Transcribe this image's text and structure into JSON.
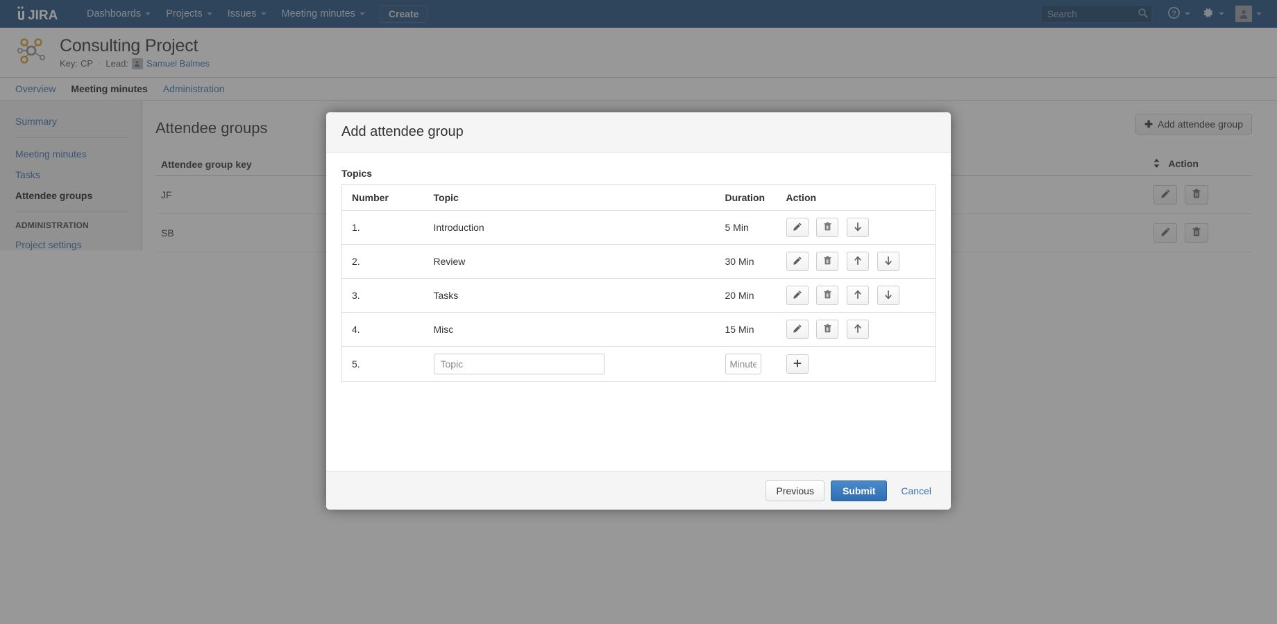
{
  "topnav": {
    "logo_text": "JIRA",
    "items": [
      {
        "label": "Dashboards",
        "has_caret": true
      },
      {
        "label": "Projects",
        "has_caret": true
      },
      {
        "label": "Issues",
        "has_caret": true
      },
      {
        "label": "Meeting minutes",
        "has_caret": true
      }
    ],
    "create_label": "Create",
    "search_placeholder": "Search",
    "search_value": "",
    "icons": [
      "search-icon",
      "help-icon",
      "gear-icon",
      "user-avatar-icon"
    ]
  },
  "project": {
    "title": "Consulting Project",
    "key_label": "Key:",
    "key_value": "CP",
    "separator": "·",
    "lead_label": "Lead:",
    "lead_name": "Samuel Balmes",
    "tabs": [
      {
        "label": "Overview",
        "active": false
      },
      {
        "label": "Meeting minutes",
        "active": true
      },
      {
        "label": "Administration",
        "active": false
      }
    ]
  },
  "sidebar": {
    "items": [
      {
        "label": "Summary",
        "active": false
      },
      {
        "label": "Meeting minutes",
        "active": false
      },
      {
        "label": "Tasks",
        "active": false
      },
      {
        "label": "Attendee groups",
        "active": true
      }
    ],
    "admin_heading": "ADMINISTRATION",
    "admin_items": [
      {
        "label": "Project settings",
        "active": false
      }
    ]
  },
  "main": {
    "page_title": "Attendee groups",
    "add_button_label": "Add attendee group",
    "add_button_icon": "plus-icon",
    "table": {
      "columns": [
        "Attendee group key",
        "Action"
      ],
      "rows": [
        {
          "key": "JF",
          "actions": [
            "edit-icon",
            "delete-icon"
          ]
        },
        {
          "key": "SB",
          "actions": [
            "edit-icon",
            "delete-icon"
          ]
        }
      ]
    }
  },
  "modal": {
    "title": "Add attendee group",
    "section_label": "Topics",
    "columns": [
      "Number",
      "Topic",
      "Duration",
      "Action"
    ],
    "rows": [
      {
        "number": "1.",
        "topic": "Introduction",
        "duration": "5 Min",
        "actions": [
          "edit-icon",
          "delete-icon",
          "move-down-icon"
        ]
      },
      {
        "number": "2.",
        "topic": "Review",
        "duration": "30 Min",
        "actions": [
          "edit-icon",
          "delete-icon",
          "move-up-icon",
          "move-down-icon"
        ]
      },
      {
        "number": "3.",
        "topic": "Tasks",
        "duration": "20 Min",
        "actions": [
          "edit-icon",
          "delete-icon",
          "move-up-icon",
          "move-down-icon"
        ]
      },
      {
        "number": "4.",
        "topic": "Misc",
        "duration": "15 Min",
        "actions": [
          "edit-icon",
          "delete-icon",
          "move-up-icon"
        ]
      }
    ],
    "new_row": {
      "number": "5.",
      "topic_placeholder": "Topic",
      "topic_value": "",
      "minutes_placeholder": "Minutes",
      "minutes_value": "",
      "add_icon": "plus-icon"
    },
    "footer": {
      "previous_label": "Previous",
      "submit_label": "Submit",
      "cancel_label": "Cancel"
    }
  },
  "colors": {
    "navbar": "#205081",
    "submit_blue": "#2f6eb0",
    "link_blue": "#3b73af",
    "project_icon_orange": "#d99d2c",
    "project_icon_gray": "#808080",
    "overlay": "rgba(60,60,60,0.53)"
  }
}
